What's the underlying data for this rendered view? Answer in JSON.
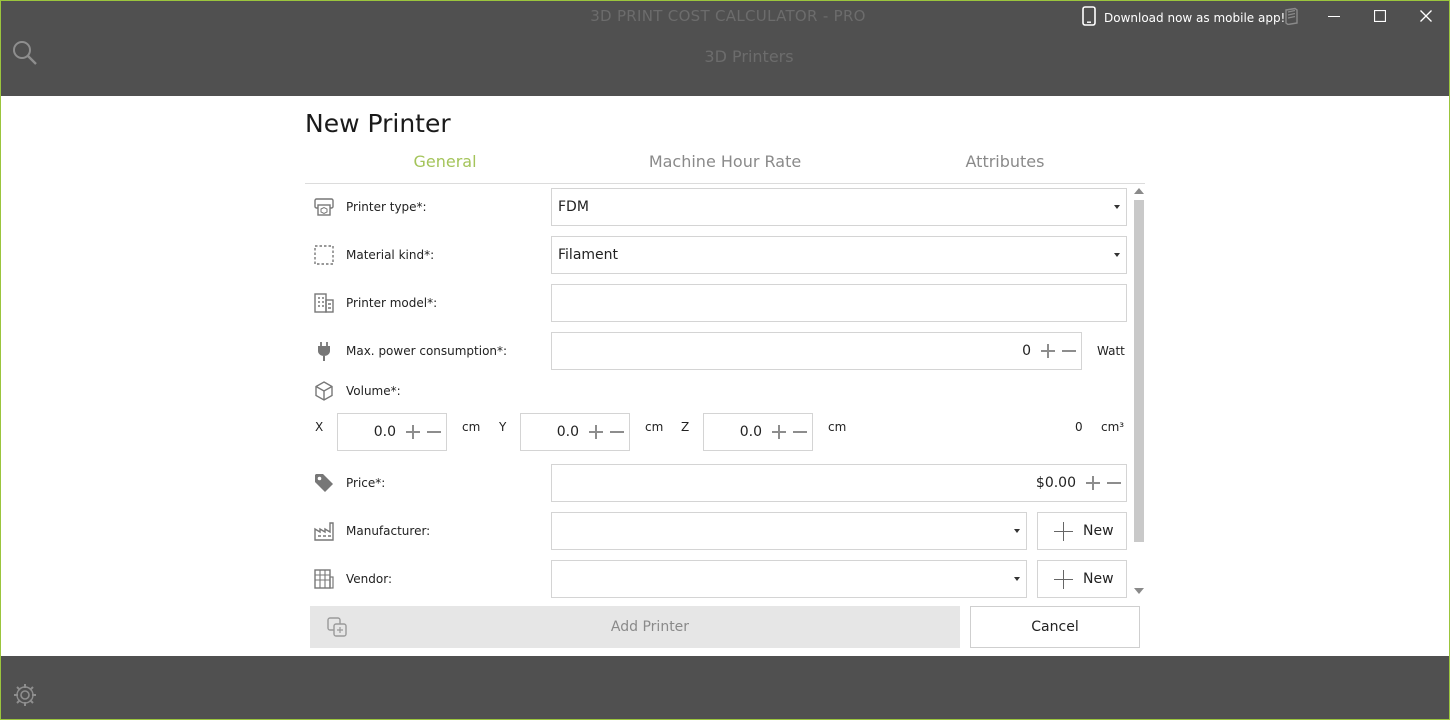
{
  "window": {
    "title": "3D PRINT COST CALCULATOR - PRO",
    "mobile_link": "Download now as mobile app!",
    "subtitle": "3D Printers"
  },
  "dialog": {
    "title": "New Printer",
    "tabs": [
      {
        "label": "General",
        "active": true
      },
      {
        "label": "Machine Hour Rate",
        "active": false
      },
      {
        "label": "Attributes",
        "active": false
      }
    ],
    "fields": {
      "printer_type": {
        "label": "Printer type*:",
        "value": "FDM"
      },
      "material_kind": {
        "label": "Material kind*:",
        "value": "Filament"
      },
      "printer_model": {
        "label": "Printer model*:",
        "value": ""
      },
      "power": {
        "label": "Max. power consumption*:",
        "value": "0",
        "unit": "Watt"
      },
      "volume": {
        "label": "Volume*:",
        "x_label": "X",
        "x_value": "0.0",
        "y_label": "Y",
        "y_value": "0.0",
        "z_label": "Z",
        "z_value": "0.0",
        "axis_unit": "cm",
        "total_value": "0",
        "total_unit": "cm³"
      },
      "price": {
        "label": "Price*:",
        "value": "$0.00"
      },
      "manufacturer": {
        "label": "Manufacturer:",
        "value": "",
        "new_label": "New"
      },
      "vendor": {
        "label": "Vendor:",
        "value": "",
        "new_label": "New"
      }
    },
    "buttons": {
      "add": "Add Printer",
      "cancel": "Cancel"
    }
  },
  "colors": {
    "accent": "#a4c45a",
    "frame": "#9bc53d",
    "overlay": "#505050"
  }
}
